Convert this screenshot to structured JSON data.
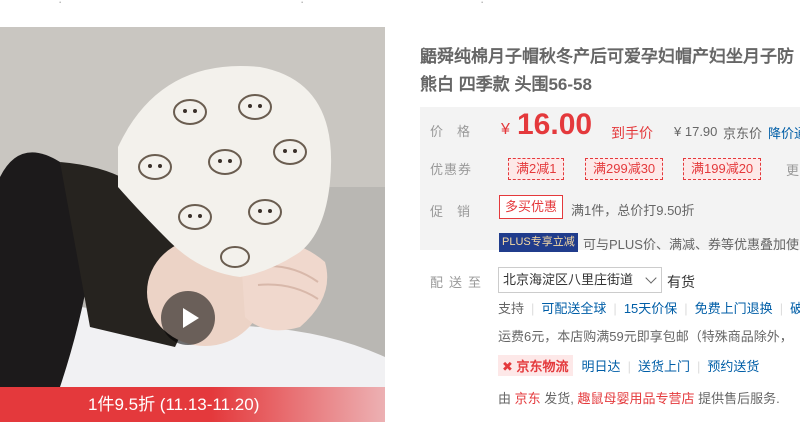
{
  "product": {
    "title_line1": "鼯舜纯棉月子帽秋冬产后可爱孕妇帽产妇坐月子防",
    "title_line2": "熊白 四季款 头围56-58"
  },
  "gallery": {
    "promo_banner": "1件9.5折 (11.13-11.20)"
  },
  "price": {
    "label": "价格",
    "currency": "¥",
    "value": "16.00",
    "tag": "到手价",
    "ref_currency": "¥",
    "ref_value": "17.90",
    "jd_price_label": "京东价",
    "drop_notice": "降价通"
  },
  "coupons": {
    "label": "优惠券",
    "items": [
      "满2减1",
      "满299减30",
      "满199减20"
    ],
    "more": "更"
  },
  "promotion": {
    "label": "促销",
    "badge": "多买优惠",
    "text": "满1件，总价打9.50折",
    "plus_badge": "PLUS专享立减",
    "plus_text": "可与PLUS价、满减、券等优惠叠加使"
  },
  "shipping": {
    "label": "配送至",
    "address": "北京海淀区八里庄街道",
    "stock": "有货",
    "support_label": "支持",
    "services": [
      "可配送全球",
      "15天价保",
      "免费上门退换",
      "破"
    ],
    "freight": "运费6元，本店购满59元即享包邮（特殊商品除外，",
    "logistics_name": "京东物流",
    "logistics_items": [
      "明日达",
      "送货上门",
      "预约送货"
    ],
    "seller_prefix": "由",
    "seller_jd": "京东",
    "seller_ship": "发货,",
    "seller_store": "趣鼠母婴用品专营店",
    "seller_suffix": "提供售后服务."
  },
  "colors": {
    "accent": "#e4393c",
    "link": "#005ea7",
    "plus_bg": "#203c8c"
  }
}
